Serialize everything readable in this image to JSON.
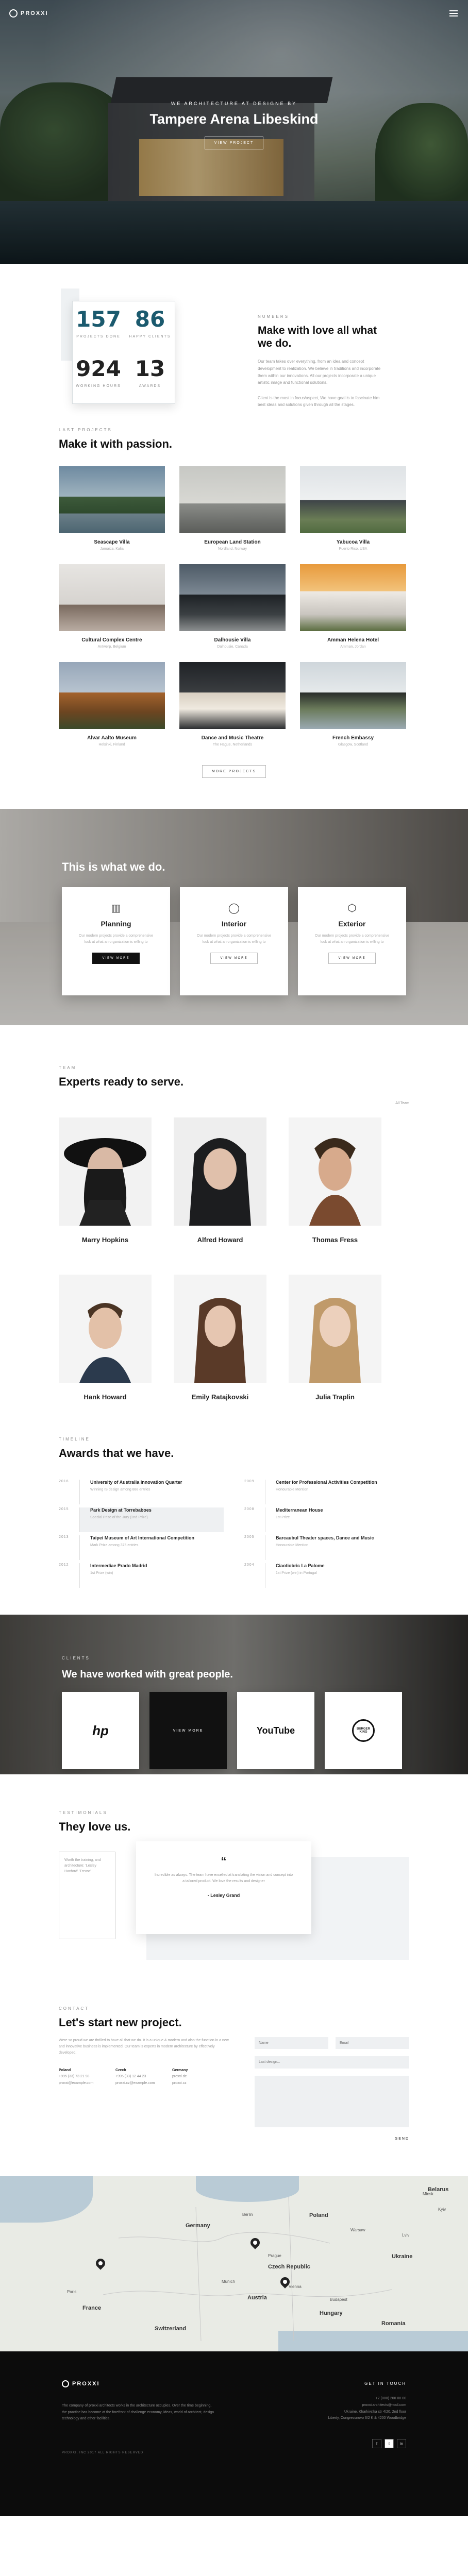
{
  "brand": {
    "name": "PROXXI"
  },
  "hero": {
    "subtitle": "WE ARCHITECTURE AT DESIGNE BY",
    "title": "Tampere Arena Libeskind",
    "button": "VIEW PROJECT"
  },
  "stats": {
    "items": [
      {
        "value": "157",
        "label": "PROJECTS DONE",
        "color": "#1b5a6e"
      },
      {
        "value": "86",
        "label": "HAPPY CLIENTS",
        "color": "#1b5a6e"
      },
      {
        "value": "924",
        "label": "WORKING HOURS",
        "color": "#111111"
      },
      {
        "value": "13",
        "label": "AWARDS",
        "color": "#111111"
      }
    ]
  },
  "about": {
    "eyebrow": "NUMBERS",
    "title": "Make with love all what we do.",
    "paragraphs": [
      "Our team takes over everything, from an idea and concept development to realization. We believe in traditions and incorporate them within our innovations. All our projects incorporate a unique artistic image and functional solutions.",
      "Client is the most in focus/aspect, We have goal is to fascinate him best ideas and solutions given through all the stages."
    ]
  },
  "projects": {
    "eyebrow": "LAST PROJECTS",
    "title": "Make it with passion.",
    "items": [
      {
        "name": "Seascape Villa",
        "location": "Jamaica, Kalia"
      },
      {
        "name": "European Land Station",
        "location": "Nordland, Norway"
      },
      {
        "name": "Yabucoa Villa",
        "location": "Puerto Rico, USA"
      },
      {
        "name": "Cultural Complex Centre",
        "location": "Antwerp, Belgium"
      },
      {
        "name": "Dalhousie Villa",
        "location": "Dalhousie, Canada"
      },
      {
        "name": "Amman Helena Hotel",
        "location": "Amman, Jordan"
      },
      {
        "name": "Alvar Aalto Museum",
        "location": "Helsinki, Finland"
      },
      {
        "name": "Dance and Music Theatre",
        "location": "The Hague, Netherlands"
      },
      {
        "name": "French Embassy",
        "location": "Glasgow, Scotland"
      }
    ],
    "more_button": "MORE PROJECTS"
  },
  "services": {
    "title": "This is what we do.",
    "items": [
      {
        "name": "Planning",
        "icon": "building-icon",
        "text": "Our modern projects provide a comprehensive look at what an organization is willing to",
        "button": "VIEW MORE"
      },
      {
        "name": "Interior",
        "icon": "lamp-icon",
        "text": "Our modern projects provide a comprehensive look at what an organization is willing to",
        "button": "VIEW MORE"
      },
      {
        "name": "Exterior",
        "icon": "cube-icon",
        "text": "Our modern projects provide a comprehensive look at what an organization is willing to",
        "button": "VIEW MORE"
      }
    ]
  },
  "team": {
    "eyebrow": "TEAM",
    "title": "Experts ready to serve.",
    "all_link": "All Team",
    "members": [
      {
        "name": "Marry Hopkins"
      },
      {
        "name": "Alfred Howard"
      },
      {
        "name": "Thomas Fress"
      },
      {
        "name": "Hank Howard"
      },
      {
        "name": "Emily Ratajkovski"
      },
      {
        "name": "Julia Traplin"
      }
    ]
  },
  "awards": {
    "eyebrow": "TIMELINE",
    "title": "Awards that we have.",
    "left": [
      {
        "year": "2016",
        "title": "University of Australia Innovation Quarter",
        "sub": "Winning IS design among 888 entries"
      },
      {
        "year": "2015",
        "title": "Park Design at Torrebaboes",
        "sub": "Special Prize of the Jury (2nd Prize)"
      },
      {
        "year": "2013",
        "title": "Taipei Museum of Art International Competition",
        "sub": "Mark Prize among 375 entries"
      },
      {
        "year": "2012",
        "title": "Intermediae Prado Madrid",
        "sub": "1st Prize (win)"
      }
    ],
    "right": [
      {
        "year": "2009",
        "title": "Center for Professional Activities Competition",
        "sub": "Honourable Mention"
      },
      {
        "year": "2008",
        "title": "Mediterranean House",
        "sub": "1st Prize"
      },
      {
        "year": "2005",
        "title": "Barcaubul Theater spaces, Dance and Music",
        "sub": "Honourable Mention"
      },
      {
        "year": "2004",
        "title": "Ciaotiobric La Palome",
        "sub": "1st Prize (win) in Portugal"
      }
    ]
  },
  "clients": {
    "eyebrow": "CLIENTS",
    "title": "We have worked with great people.",
    "logos": [
      {
        "name": "hp",
        "label": "hp"
      },
      {
        "name": "view-more",
        "label": "VIEW MORE"
      },
      {
        "name": "youtube",
        "label": "YouTube"
      },
      {
        "name": "burger-king",
        "label": "BURGER KING"
      }
    ]
  },
  "testimonials": {
    "eyebrow": "TESTIMONIALS",
    "title": "They love us.",
    "left_card": "Worth the training, and architecture: 'Lesley Hanford' 'Trevor'",
    "quote": "Incredible as always. The team have excelled at translating the vision and concept into a tailored product. We love the results and designer",
    "author": "- Lesley Grand"
  },
  "contact": {
    "eyebrow": "CONTACT",
    "title": "Let's start new project.",
    "description": "Were so proud we are thrilled to have all that we do. It is a unique & modern and also the function in a new and innovative business is implemented. Our team is experts in modern architecture by effectively developed.",
    "columns": [
      {
        "head": "Poland",
        "lines": [
          "+995 (33) 73 21 98",
          "proxxi@example.com"
        ]
      },
      {
        "head": "Czech",
        "lines": [
          "+995 (33) 12 44 23",
          "proxxi.cz@example.com"
        ]
      },
      {
        "head": "Germany",
        "lines": [
          "proxxi.de",
          "proxxi.cz"
        ]
      }
    ],
    "form": {
      "name_placeholder": "Name",
      "email_placeholder": "Email",
      "select": "Last design...",
      "message_placeholder": "",
      "send": "SEND"
    }
  },
  "map": {
    "countries": [
      "Belarus",
      "Germany",
      "Poland",
      "Ukraine",
      "France",
      "Austria",
      "Hungary",
      "Romania",
      "Switzerland",
      "Czech Republic"
    ],
    "cities": [
      "Berlin",
      "Warsaw",
      "Kyiv",
      "Prague",
      "Vienna",
      "Budapest",
      "Munich",
      "Paris",
      "Minsk",
      "Lviv"
    ]
  },
  "footer": {
    "about": "The company of proxxi architects works in the architecture occupies. Over the time beginning, the practice has become at the forefront of challenge economy, ideas, world of architect, design technology and other facilities.",
    "copyright": "PROXXI, INC 2017 ALL RIGHTS RESERVED",
    "contact_head": "GET IN TOUCH",
    "contact_lines": [
      "+7 (800) 200 00 00",
      "proxxi.architects@mail.com",
      "Ukraine, Kharkivs'ka str 4/20, 2nd floor",
      "Liberty, Congressnovo 6/2 K & 4200 Woodbridge"
    ],
    "social": [
      "f",
      "t",
      "in"
    ]
  }
}
